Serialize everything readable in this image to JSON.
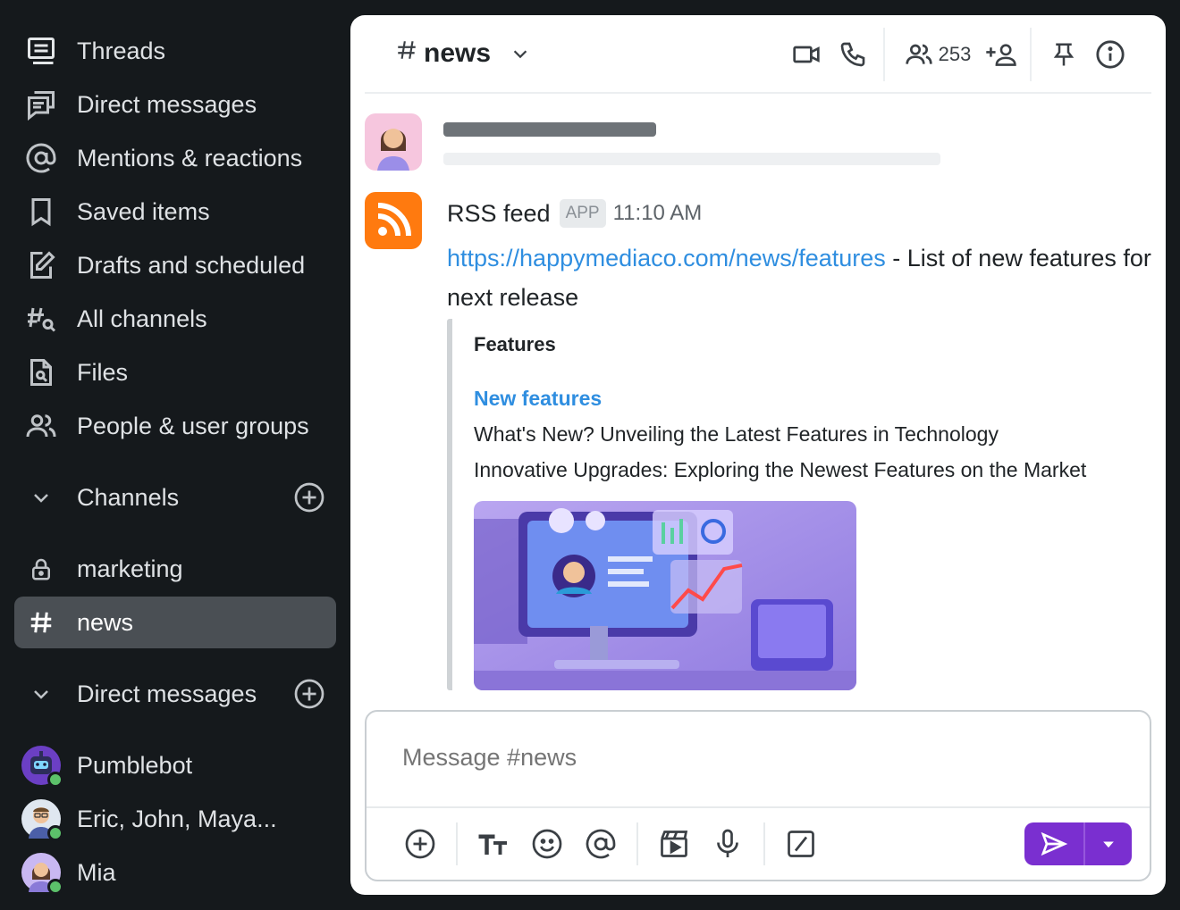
{
  "sidebar": {
    "items": [
      {
        "label": "Threads",
        "icon": "threads-icon"
      },
      {
        "label": "Direct messages",
        "icon": "direct-messages-icon"
      },
      {
        "label": "Mentions & reactions",
        "icon": "at-icon"
      },
      {
        "label": "Saved items",
        "icon": "bookmark-icon"
      },
      {
        "label": "Drafts and scheduled",
        "icon": "draft-edit-icon"
      },
      {
        "label": "All channels",
        "icon": "channel-search-icon"
      },
      {
        "label": "Files",
        "icon": "file-search-icon"
      },
      {
        "label": "People & user groups",
        "icon": "people-icon"
      }
    ],
    "channels_section": {
      "label": "Channels"
    },
    "channels": [
      {
        "label": "marketing",
        "icon": "lock-icon"
      },
      {
        "label": "news",
        "icon": "hash-icon",
        "active": true
      }
    ],
    "dm_section": {
      "label": "Direct messages"
    },
    "dms": [
      {
        "label": "Pumblebot",
        "status": "online"
      },
      {
        "label": "Eric, John, Maya...",
        "status": "online"
      },
      {
        "label": "Mia",
        "status": "online"
      }
    ]
  },
  "header": {
    "channel_name": "news",
    "member_count": "253"
  },
  "message": {
    "author": "RSS feed",
    "badge": "APP",
    "time": "11:10 AM",
    "link_text": "https://happymediaco.com/news/features",
    "text_suffix": " - List of new features for next release",
    "embed": {
      "title": "Features",
      "link": "New features",
      "lines": [
        "What's New? Unveiling the Latest Features in Technology",
        "Innovative Upgrades: Exploring the Newest Features on the Market"
      ]
    }
  },
  "composer": {
    "placeholder": "Message #news"
  },
  "colors": {
    "sidebar_bg": "#15191c",
    "accent_purple": "#7a2fd0",
    "link_blue": "#2f8ee0",
    "rss_orange": "#ff7a0f",
    "online_green": "#5cc16a"
  }
}
